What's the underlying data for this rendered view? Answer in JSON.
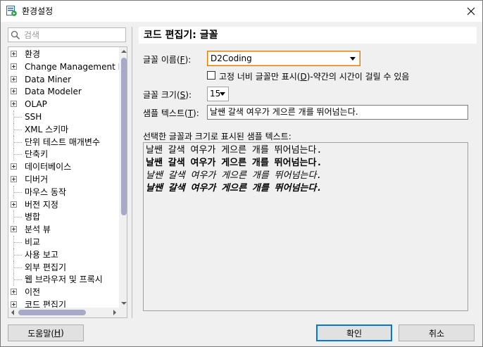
{
  "window": {
    "title": "환경설정",
    "close_glyph": "✕"
  },
  "search": {
    "placeholder": "검색"
  },
  "tree": {
    "items": [
      {
        "label": "환경",
        "expandable": true
      },
      {
        "label": "Change Management D",
        "expandable": true
      },
      {
        "label": "Data Miner",
        "expandable": true
      },
      {
        "label": "Data Modeler",
        "expandable": true
      },
      {
        "label": "OLAP",
        "expandable": true
      },
      {
        "label": "SSH",
        "expandable": false
      },
      {
        "label": "XML 스키마",
        "expandable": false
      },
      {
        "label": "단위 테스트 매개변수",
        "expandable": false
      },
      {
        "label": "단축키",
        "expandable": false
      },
      {
        "label": "데이터베이스",
        "expandable": true
      },
      {
        "label": "디버거",
        "expandable": true
      },
      {
        "label": "마우스 동작",
        "expandable": false
      },
      {
        "label": "버전 지정",
        "expandable": true
      },
      {
        "label": "병합",
        "expandable": false
      },
      {
        "label": "분석 뷰",
        "expandable": true
      },
      {
        "label": "비교",
        "expandable": false
      },
      {
        "label": "사용 보고",
        "expandable": false
      },
      {
        "label": "외부 편집기",
        "expandable": false
      },
      {
        "label": "웹 브라우저 및 프록시",
        "expandable": false
      },
      {
        "label": "이전",
        "expandable": true
      },
      {
        "label": "코드 편집기",
        "expandable": true
      }
    ]
  },
  "panel": {
    "title": "코드 편집기: 글꼴",
    "font_name_label": "글꼴 이름(",
    "font_name_key": "F",
    "font_name_label_end": "):",
    "font_name_value": "D2Coding",
    "monospace_only_label_a": "고정 너비 글꼴만 표시(",
    "monospace_only_key": "D",
    "monospace_only_label_b": ")-약간의 시간이 걸릴 수 있음",
    "monospace_only_checked": false,
    "font_size_label": "글꼴 크기(",
    "font_size_key": "S",
    "font_size_label_end": "):",
    "font_size_value": "15",
    "sample_label": "샘플 텍스트(",
    "sample_key": "T",
    "sample_label_end": "):",
    "sample_value": "날쌘 갈색 여우가 게으른 개를 뛰어넘는다.",
    "preview_label": "선택한 글꼴과 크기로 표시된 샘플 텍스트:",
    "preview_lines": [
      {
        "text": "날쌘 갈색 여우가 게으른 개를 뛰어넘는다.",
        "style": "regular"
      },
      {
        "text": "날쌘 갈색 여우가 게으른 개를 뛰어넘는다.",
        "style": "bold"
      },
      {
        "text": "날쌘 갈색 여우가 게으른 개를 뛰어넘는다.",
        "style": "italic"
      },
      {
        "text": "날쌘 갈색 여우가 게으른 개를 뛰어넘는다.",
        "style": "bold-italic"
      }
    ]
  },
  "buttons": {
    "help_label": "도움말(",
    "help_key": "H",
    "help_label_end": ")",
    "ok_label": "확인",
    "cancel_label": "취소"
  },
  "colors": {
    "focus_border": "#e07a00",
    "default_button_border": "#0078d7",
    "scroll_thumb": "#a8a8c8"
  }
}
